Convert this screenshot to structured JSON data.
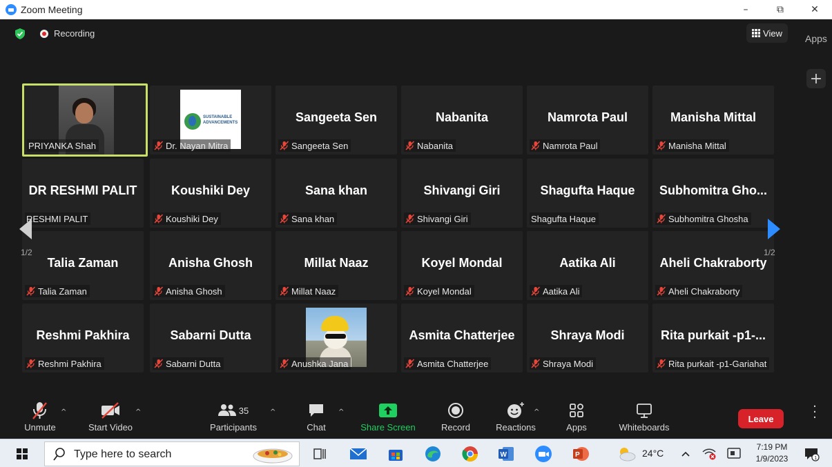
{
  "window": {
    "title": "Zoom Meeting",
    "minimize": "–",
    "maximize": "⧉",
    "close": "✕"
  },
  "top": {
    "recording_label": "Recording",
    "view_label": "View",
    "apps_label": "Apps",
    "plus": "+"
  },
  "pager": {
    "left_page": "1/2",
    "right_page": "1/2"
  },
  "tiles": [
    {
      "big": "",
      "label": "PRIYANKA Shah",
      "muted": false,
      "type": "video"
    },
    {
      "big": "",
      "label": "Dr. Nayan Mitra",
      "muted": true,
      "type": "logo"
    },
    {
      "big": "Sangeeta Sen",
      "label": "Sangeeta Sen",
      "muted": true
    },
    {
      "big": "Nabanita",
      "label": "Nabanita",
      "muted": true
    },
    {
      "big": "Namrota Paul",
      "label": "Namrota Paul",
      "muted": true
    },
    {
      "big": "Manisha Mittal",
      "label": "Manisha Mittal",
      "muted": true
    },
    {
      "big": "DR RESHMI PALIT",
      "label": "RESHMI PALIT",
      "muted": false
    },
    {
      "big": "Koushiki Dey",
      "label": "Koushiki Dey",
      "muted": true
    },
    {
      "big": "Sana khan",
      "label": "Sana khan",
      "muted": true
    },
    {
      "big": "Shivangi Giri",
      "label": "Shivangi Giri",
      "muted": true
    },
    {
      "big": "Shagufta Haque",
      "label": "Shagufta Haque",
      "muted": false
    },
    {
      "big": "Subhomitra Gho...",
      "label": "Subhomitra Ghosha",
      "muted": true
    },
    {
      "big": "Talia Zaman",
      "label": "Talia Zaman",
      "muted": true
    },
    {
      "big": "Anisha Ghosh",
      "label": "Anisha Ghosh",
      "muted": true
    },
    {
      "big": "Millat Naaz",
      "label": "Millat Naaz",
      "muted": true
    },
    {
      "big": "Koyel Mondal",
      "label": "Koyel Mondal",
      "muted": true
    },
    {
      "big": "Aatika Ali",
      "label": "Aatika Ali",
      "muted": true
    },
    {
      "big": "Aheli Chakraborty",
      "label": "Aheli Chakraborty",
      "muted": true
    },
    {
      "big": "Reshmi Pakhira",
      "label": "Reshmi Pakhira",
      "muted": true
    },
    {
      "big": "Sabarni Dutta",
      "label": "Sabarni Dutta",
      "muted": true
    },
    {
      "big": "",
      "label": "Anushka Jana",
      "muted": true,
      "type": "cat"
    },
    {
      "big": "Asmita Chatterjee",
      "label": "Asmita Chatterjee",
      "muted": true
    },
    {
      "big": "Shraya Modi",
      "label": "Shraya Modi",
      "muted": true
    },
    {
      "big": "Rita purkait -p1-...",
      "label": "Rita purkait -p1-Gariahat",
      "muted": true
    }
  ],
  "logo_text": "SUSTAINABLE ADVANCEMENTS",
  "toolbar": {
    "unmute": "Unmute",
    "start_video": "Start Video",
    "participants": "Participants",
    "participants_count": "35",
    "chat": "Chat",
    "share_screen": "Share Screen",
    "record": "Record",
    "reactions": "Reactions",
    "apps": "Apps",
    "whiteboards": "Whiteboards",
    "leave": "Leave"
  },
  "taskbar": {
    "search_placeholder": "Type here to search",
    "temperature": "24°C",
    "time": "7:19 PM",
    "date": "1/9/2023"
  },
  "colors": {
    "accent": "#2d8cff",
    "active_speaker": "#c8e06a",
    "leave": "#d8222a",
    "share": "#1fcf5f",
    "mute_red": "#e8463a"
  }
}
